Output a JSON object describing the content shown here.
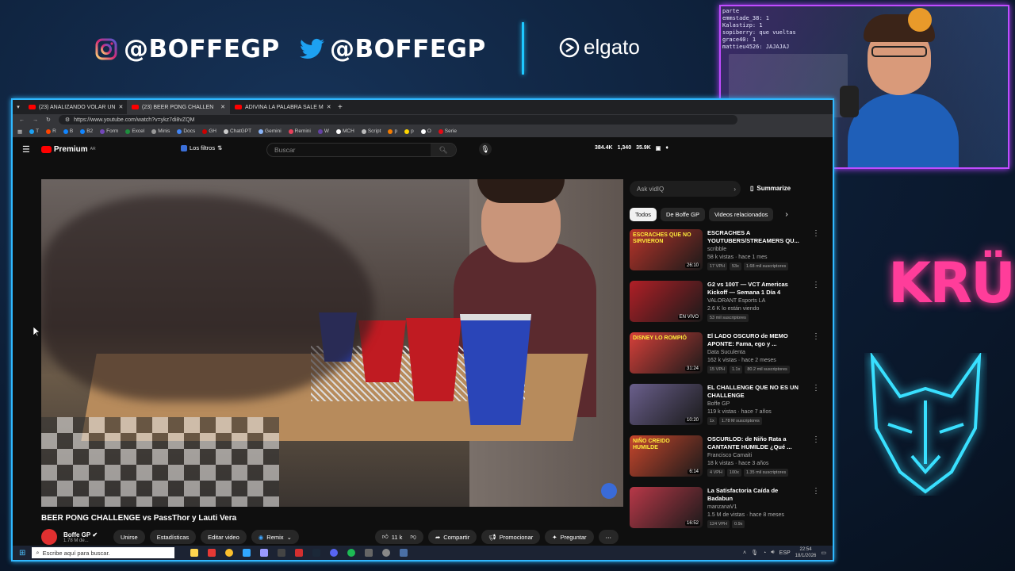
{
  "overlay": {
    "instagram_handle": "@BOFFEGP",
    "twitter_handle": "@BOFFEGP",
    "sponsor": "elgato",
    "team_logo_text": "KRÜ",
    "chat_lines": [
      "parte",
      "emmstade_38: 1",
      "Kalastizp: 1",
      "sopiberry: que vueltas",
      "grace40: 1",
      "mattieu4526: JAJAJAJ"
    ]
  },
  "browser": {
    "tabs": [
      {
        "label": "(23) ANALIZANDO VOLAR UN"
      },
      {
        "label": "(23) BEER PONG CHALLEN"
      },
      {
        "label": "ADIVINA LA PALABRA SALE M"
      }
    ],
    "url": "https://www.youtube.com/watch?v=ykz7di8vZQM",
    "bookmarks": [
      "T",
      "R",
      "B",
      "B2",
      "Form",
      "Excel",
      "Minis",
      "Docs",
      "GH",
      "ChatGPT",
      "Gemini",
      "Remini",
      "W",
      "MCH",
      "Script",
      "p",
      "p",
      "O",
      "Serie"
    ]
  },
  "youtube": {
    "logo": "Premium",
    "logo_badge": "AR",
    "filters_label": "Los filtros",
    "search_placeholder": "Buscar",
    "stats": [
      "384.4K",
      "1,340",
      "35.9K"
    ],
    "ask_placeholder": "Ask vidIQ",
    "summarize_label": "Summarize",
    "chips": [
      "Todos",
      "De Boffe GP",
      "Videos relacionados"
    ],
    "video_title": "BEER PONG CHALLENGE vs PassThor y Lauti Vera",
    "channel_name": "Boffe GP",
    "subscribers": "1.78 M de...",
    "buttons": {
      "join": "Unirse",
      "stats": "Estadísticas",
      "edit": "Editar video",
      "remix": "Remix",
      "likes": "11 k",
      "share": "Compartir",
      "promote": "Promocionar",
      "ask": "Preguntar"
    },
    "recommendations": [
      {
        "title": "ESCRACHES A YOUTUBERS/STREAMERS QU...",
        "channel": "scribble",
        "info": "58 k vistas · hace 1 mes",
        "badges": [
          "17 VPH",
          "53x",
          "1.68 mil suscriptores"
        ],
        "duration": "26:10",
        "thumb_text": "ESCRACHES QUE NO SIRVIERON",
        "color": "#b8342a"
      },
      {
        "title": "G2 vs 100T — VCT Americas Kickoff — Semana 1 Día 4",
        "channel": "VALORANT Esports LA",
        "info": "2.6 K lo están viendo",
        "badges": [
          "53 mil suscriptores"
        ],
        "duration": "EN VIVO",
        "thumb_text": "",
        "color": "#b01f26"
      },
      {
        "title": "El LADO OSCURO de MEMO APONTE: Fama, ego y ...",
        "channel": "Data Suculenta",
        "info": "162 k vistas · hace 2 meses",
        "badges": [
          "15 VPH",
          "1.1x",
          "80.2 mil suscriptores"
        ],
        "duration": "31:24",
        "thumb_text": "DISNEY LO ROMPIÓ",
        "color": "#d7403a"
      },
      {
        "title": "EL CHALLENGE QUE NO ES UN CHALLENGE",
        "channel": "Boffe GP",
        "info": "119 k vistas · hace 7 años",
        "badges": [
          "1x",
          "1.78 M suscriptores"
        ],
        "duration": "10:20",
        "thumb_text": "",
        "color": "#6a5f8c"
      },
      {
        "title": "OSCURLOD: de Niño Rata a CANTANTE HUMILDE ¿Qué ...",
        "channel": "Francisco Camaiti",
        "info": "18 k vistas · hace 3 años",
        "badges": [
          "4 VPH",
          "100x",
          "1.35 mil suscriptores"
        ],
        "duration": "6:14",
        "thumb_text": "NIÑO CREIDO HUMILDE",
        "color": "#c7462c"
      },
      {
        "title": "La Satisfactoria Caída de Badabun",
        "channel": "manzanaV1",
        "info": "1.5 M de vistas · hace 8 meses",
        "badges": [
          "124 VPH",
          "0.9x"
        ],
        "duration": "16:52",
        "thumb_text": "",
        "color": "#b83848"
      }
    ]
  },
  "taskbar": {
    "search_placeholder": "Escribe aquí para buscar.",
    "lang": "ESP",
    "time": "22:54",
    "date": "18/1/2026"
  }
}
